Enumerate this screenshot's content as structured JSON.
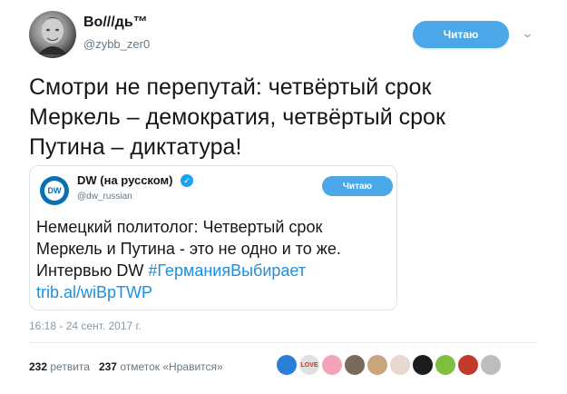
{
  "tweet": {
    "display_name": "Во///дь™",
    "handle": "@zybb_zer0",
    "follow_label": "Читаю",
    "text_line1": "Смотри не перепутай: четвёртый срок",
    "text_line2": "Меркель – демократия, четвёртый срок",
    "text_line3": "Путина – диктатура!",
    "timestamp": "16:18 - 24 сент. 2017 г.",
    "retweets_count": "232",
    "retweets_label": "ретвита",
    "likes_count": "237",
    "likes_label": "отметок «Нравится»"
  },
  "quoted": {
    "logo_text": "DW",
    "name": "DW (на русском)",
    "verified_icon": "check-icon",
    "handle": "@dw_russian",
    "follow_label": "Читаю",
    "text_line1": "Немецкий политолог: Четвертый срок",
    "text_line2": "Меркель и Путина - это не одно и то же.",
    "text_line3_prefix": "Интервью DW ",
    "hashtag": "#ГерманияВыбирает",
    "link": "trib.al/wiBpTWP"
  },
  "likers": [
    {
      "color": "#2b7fd4",
      "label": ""
    },
    {
      "color": "#e0e0e0",
      "label": "LOVE"
    },
    {
      "color": "#f5a3b8",
      "label": ""
    },
    {
      "color": "#7a6a5a",
      "label": ""
    },
    {
      "color": "#c9a57e",
      "label": ""
    },
    {
      "color": "#e8d8d0",
      "label": ""
    },
    {
      "color": "#1c1c1c",
      "label": ""
    },
    {
      "color": "#7fbf3f",
      "label": ""
    },
    {
      "color": "#c0392b",
      "label": ""
    },
    {
      "color": "#bdbdbd",
      "label": ""
    }
  ]
}
